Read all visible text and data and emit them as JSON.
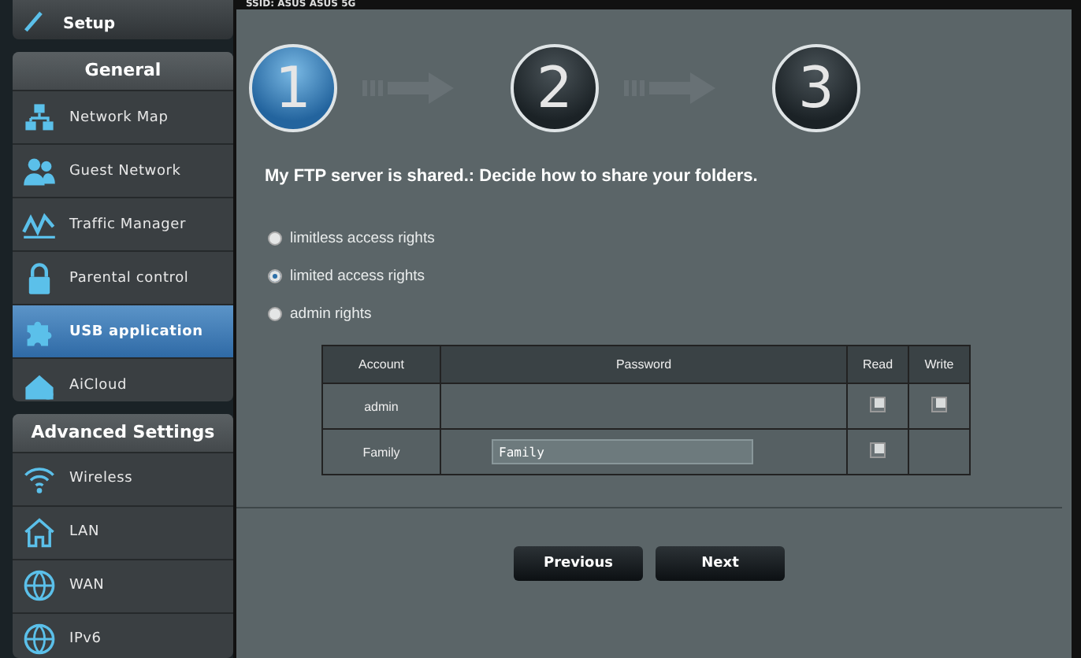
{
  "header": {
    "ssid": "SSID: ASUS  ASUS 5G"
  },
  "sidebar": {
    "quick_setup": "Setup",
    "sections": [
      {
        "title": "General",
        "items": [
          {
            "label": "Network Map",
            "kind": "network",
            "selected": false
          },
          {
            "label": "Guest Network",
            "kind": "guest",
            "selected": false
          },
          {
            "label": "Traffic Manager",
            "kind": "traffic",
            "selected": false
          },
          {
            "label": "Parental control",
            "kind": "lock",
            "selected": false
          },
          {
            "label": "USB application",
            "kind": "puzzle",
            "selected": true
          },
          {
            "label": "AiCloud",
            "kind": "cloud",
            "selected": false
          }
        ]
      },
      {
        "title": "Advanced Settings",
        "items": [
          {
            "label": "Wireless",
            "kind": "wifi",
            "selected": false
          },
          {
            "label": "LAN",
            "kind": "home",
            "selected": false
          },
          {
            "label": "WAN",
            "kind": "globe",
            "selected": false
          },
          {
            "label": "IPv6",
            "kind": "globe",
            "selected": false
          }
        ]
      }
    ]
  },
  "steps": [
    {
      "label": "1",
      "selected": true
    },
    {
      "label": "2",
      "selected": false
    },
    {
      "label": "3",
      "selected": false
    }
  ],
  "heading": "My FTP server is shared.: Decide how to share your folders.",
  "options": [
    {
      "label": "limitless access rights",
      "selected": false
    },
    {
      "label": "limited access rights",
      "selected": true
    },
    {
      "label": "admin rights",
      "selected": false
    }
  ],
  "table": {
    "columns": [
      "Account",
      "Password",
      "Read",
      "Write"
    ],
    "rows": [
      {
        "account": "admin",
        "read": {
          "checked": true
        },
        "write": {
          "checked": true
        }
      },
      {
        "account": "Family",
        "password": "Family",
        "read": {
          "checked": true
        }
      }
    ]
  },
  "buttons": [
    "Previous",
    "Next"
  ]
}
